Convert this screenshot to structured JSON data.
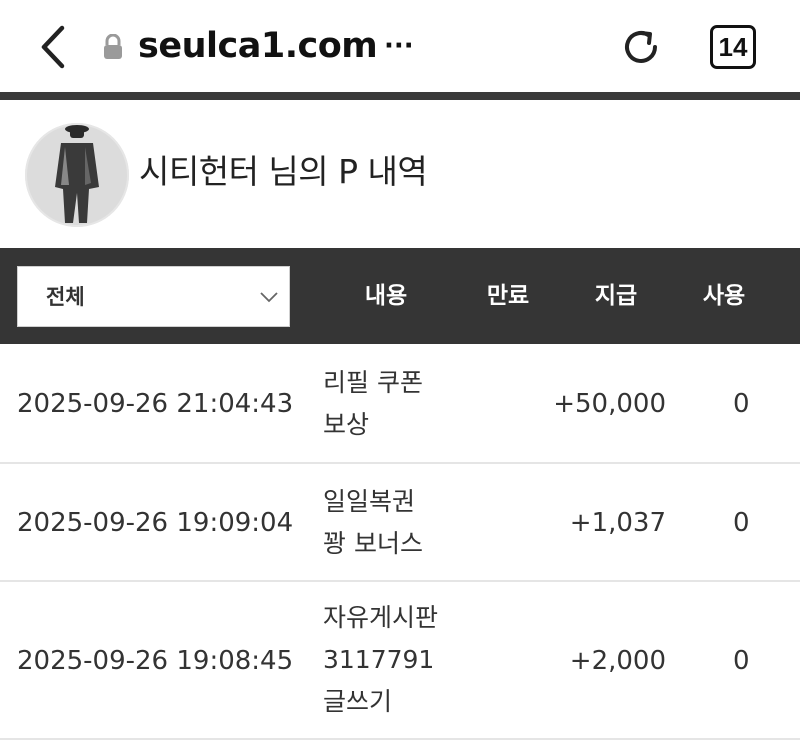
{
  "browser": {
    "url": "seulca1.com",
    "url_overflow": "···",
    "tab_count": "14"
  },
  "profile": {
    "title": "시티헌터 님의 P 내역"
  },
  "filter": {
    "selected": "전체",
    "columns": [
      "내용",
      "만료",
      "지급",
      "사용"
    ]
  },
  "rows": [
    {
      "date": "2025-09-26 21:04:43",
      "content": [
        "리필 쿠폰",
        "보상"
      ],
      "given": "+50,000",
      "used": "0"
    },
    {
      "date": "2025-09-26 19:09:04",
      "content": [
        "일일복권",
        "꽝 보너스"
      ],
      "given": "+1,037",
      "used": "0"
    },
    {
      "date": "2025-09-26 19:08:45",
      "content": [
        "자유게시판",
        "3117791",
        "글쓰기"
      ],
      "given": "+2,000",
      "used": "0"
    }
  ],
  "icons": {
    "back": "chevron-left-icon",
    "lock": "lock-icon",
    "reload": "reload-icon",
    "tabs": "tabs-icon",
    "dropdown": "chevron-down-icon"
  },
  "colors": {
    "header_bar": "#353535",
    "divider": "#3a3a3a",
    "text": "#333333"
  }
}
